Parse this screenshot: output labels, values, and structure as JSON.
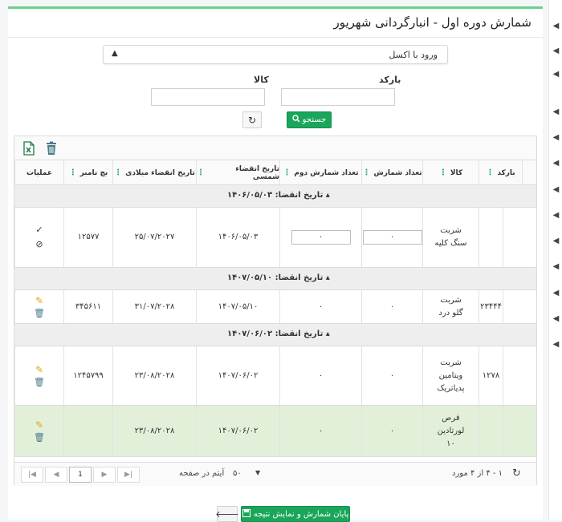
{
  "page": {
    "title": "شمارش دوره اول - انبارگردانی شهریور"
  },
  "excel_panel": {
    "label": "ورود با اکسل"
  },
  "filters": {
    "barcode_label": "بارکد",
    "goods_label": "کالا",
    "barcode_value": "",
    "goods_value": ""
  },
  "buttons": {
    "search": "جستجو",
    "finish": "پایان شمارش و نمایش نتیجه"
  },
  "table": {
    "columns": [
      "بارکد",
      "کالا",
      "تعداد شمارش",
      "تعداد شمارش دوم",
      "تاریخ انقضاء شمسی",
      "تاریخ انقضاء میلادی",
      "بچ نامبر",
      "عملیات"
    ],
    "groups": [
      {
        "label": "تاریخ انقضا: ۱۴۰۶/۰۵/۰۳",
        "rows": [
          {
            "barcode": "",
            "goods": "شربت سنگ کلیه",
            "count": "۰",
            "count2": "۰",
            "exp_shamsi": "۱۴۰۶/۰۵/۰۳",
            "exp_miladi": "۲۵/۰۷/۲۰۲۷",
            "batch": "۱۲۵۷۷",
            "editing": true,
            "selected": false
          }
        ]
      },
      {
        "label": "تاریخ انقضا: ۱۴۰۷/۰۵/۱۰",
        "rows": [
          {
            "barcode": "۲۳۴۴۴",
            "goods": "شربت گلو درد",
            "count": "۰",
            "count2": "۰",
            "exp_shamsi": "۱۴۰۷/۰۵/۱۰",
            "exp_miladi": "۳۱/۰۷/۲۰۲۸",
            "batch": "۳۴۵۶۱۱",
            "editing": false,
            "selected": false
          }
        ]
      },
      {
        "label": "تاریخ انقضا: ۱۴۰۷/۰۶/۰۲",
        "rows": [
          {
            "barcode": "۱۲۷۸",
            "goods": "شربت ویتامین پدیاتریک",
            "count": "۰",
            "count2": "۰",
            "exp_shamsi": "۱۴۰۷/۰۶/۰۲",
            "exp_miladi": "۲۳/۰۸/۲۰۲۸",
            "batch": "۱۲۴۵۷۹۹",
            "editing": false,
            "selected": false
          },
          {
            "barcode": "",
            "goods": "قرص لورتادین ۱۰",
            "count": "۰",
            "count2": "۰",
            "exp_shamsi": "۱۴۰۷/۰۶/۰۲",
            "exp_miladi": "۲۳/۰۸/۲۰۲۸",
            "batch": "",
            "editing": false,
            "selected": true
          }
        ]
      }
    ]
  },
  "pager": {
    "summary": "۱ - ۴ از ۴ مورد",
    "page_size": "۵۰",
    "page_size_label": "آیتم در صفحه",
    "current_page": "1"
  },
  "colors": {
    "accent": "#1aa65a",
    "selected_row": "#e2f0d9"
  }
}
